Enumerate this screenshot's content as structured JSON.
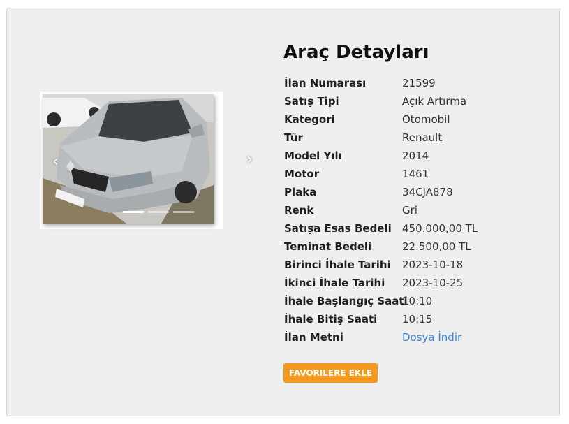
{
  "title": "Araç Detayları",
  "details": [
    {
      "label": "İlan Numarası",
      "value": "21599"
    },
    {
      "label": "Satış Tipi",
      "value": "Açık Artırma"
    },
    {
      "label": "Kategori",
      "value": "Otomobil"
    },
    {
      "label": "Tür",
      "value": "Renault"
    },
    {
      "label": "Model Yılı",
      "value": "2014"
    },
    {
      "label": "Motor",
      "value": "1461"
    },
    {
      "label": "Plaka",
      "value": "34CJA878"
    },
    {
      "label": "Renk",
      "value": "Gri"
    },
    {
      "label": "Satışa Esas Bedeli",
      "value": "450.000,00 TL"
    },
    {
      "label": "Teminat Bedeli",
      "value": "22.500,00 TL"
    },
    {
      "label": "Birinci İhale Tarihi",
      "value": "2023-10-18"
    },
    {
      "label": "İkinci İhale Tarihi",
      "value": "2023-10-25"
    },
    {
      "label": "İhale Başlangıç Saati",
      "value": "10:10"
    },
    {
      "label": "İhale Bitiş Saati",
      "value": "10:15"
    },
    {
      "label": "İlan Metni",
      "value": "Dosya İndir"
    }
  ],
  "favorite_button": "FAVORILERE EKLE",
  "carousel": {
    "slide_count": 3,
    "active_index": 0,
    "prev_icon": "chevron-left-icon",
    "next_icon": "chevron-right-icon"
  },
  "colors": {
    "panel_bg": "#efefef",
    "accent_button": "#f39a1e",
    "link": "#3a86d6"
  }
}
